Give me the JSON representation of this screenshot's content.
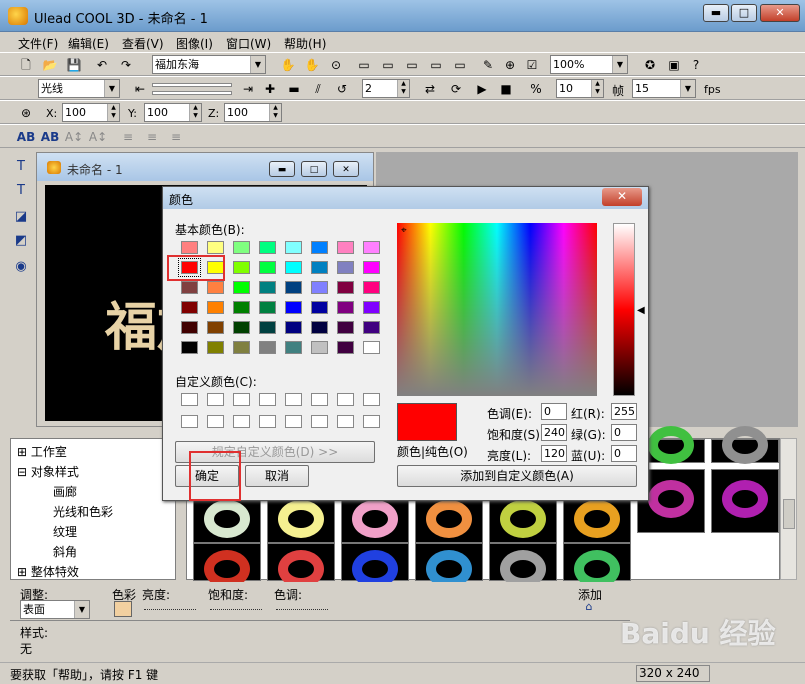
{
  "window": {
    "title": "Ulead COOL 3D - 未命名 - 1",
    "min": "▬",
    "max": "□",
    "close": "✕"
  },
  "menu": [
    "文件(F)",
    "编辑(E)",
    "查看(V)",
    "图像(I)",
    "窗口(W)",
    "帮助(H)"
  ],
  "toolbar1": {
    "font_value": "福加东海",
    "zoom_value": "100%"
  },
  "toolbar2": {
    "mode_value": "光线",
    "frame_spin": "2",
    "fps_spin": "10",
    "frames_label": "帧",
    "frames_value": "15",
    "fps_label": "fps"
  },
  "toolbar3": {
    "x_label": "X:",
    "x_value": "100",
    "y_label": "Y:",
    "y_value": "100",
    "z_label": "Z:",
    "z_value": "100"
  },
  "canvas_window": {
    "title": "未命名 - 1",
    "text": "福加"
  },
  "tree": [
    "工作室",
    "对象样式",
    "画廊",
    "光线和色彩",
    "纹理",
    "斜角",
    "整体特效"
  ],
  "props": {
    "adjust_label": "调整:",
    "adjust_value": "表面",
    "color_label": "色彩",
    "brightness_label": "亮度:",
    "saturation_label": "饱和度:",
    "hue_label": "色调:",
    "add_label": "添加",
    "style_label": "样式:",
    "style_value": "无"
  },
  "status": {
    "text": "要获取「帮助」，请按 F1 键",
    "size": "320 x 240"
  },
  "dialog": {
    "title": "颜色",
    "close": "✕",
    "basic_colors_label": "基本颜色(B):",
    "custom_colors_label": "自定义颜色(C):",
    "define_custom_button": "规定自定义颜色(D) >>",
    "ok_button": "确定",
    "cancel_button": "取消",
    "color_solid_label": "颜色|纯色(O)",
    "hue_label": "色调(E):",
    "hue_value": "0",
    "sat_label": "饱和度(S):",
    "sat_value": "240",
    "lum_label": "亮度(L):",
    "lum_value": "120",
    "red_label": "红(R):",
    "red_value": "255",
    "green_label": "绿(G):",
    "green_value": "0",
    "blue_label": "蓝(U):",
    "blue_value": "0",
    "add_custom_button": "添加到自定义颜色(A)",
    "selected_color": "#ff0000",
    "basic_colors": [
      [
        "#ff8080",
        "#ffff80",
        "#80ff80",
        "#00ff80",
        "#80ffff",
        "#0080ff",
        "#ff80c0",
        "#ff80ff"
      ],
      [
        "#ff0000",
        "#ffff00",
        "#80ff00",
        "#00ff40",
        "#00ffff",
        "#0080c0",
        "#8080c0",
        "#ff00ff"
      ],
      [
        "#804040",
        "#ff8040",
        "#00ff00",
        "#008080",
        "#004080",
        "#8080ff",
        "#800040",
        "#ff0080"
      ],
      [
        "#800000",
        "#ff8000",
        "#008000",
        "#008040",
        "#0000ff",
        "#0000a0",
        "#800080",
        "#8000ff"
      ],
      [
        "#400000",
        "#804000",
        "#004000",
        "#004040",
        "#000080",
        "#000040",
        "#400040",
        "#400080"
      ],
      [
        "#000000",
        "#808000",
        "#808040",
        "#808080",
        "#408080",
        "#c0c0c0",
        "#400040",
        "#ffffff"
      ]
    ]
  },
  "watermark": "Baidu 经验"
}
